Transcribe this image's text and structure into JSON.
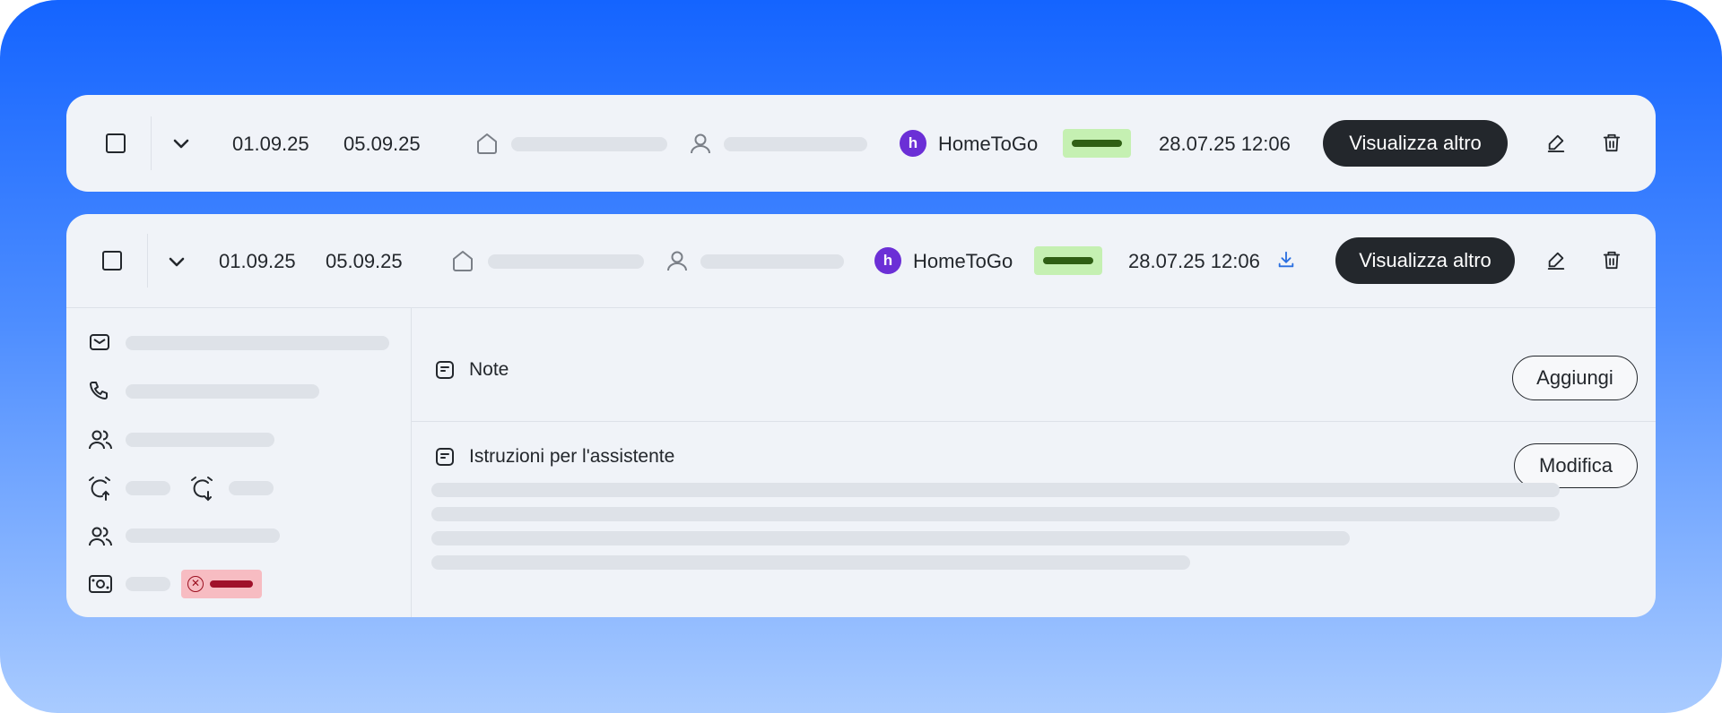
{
  "rows": [
    {
      "checkin": "01.09.25",
      "checkout": "05.09.25",
      "channel": "HomeToGo",
      "channel_logo": "h",
      "timestamp": "28.07.25 12:06",
      "more_label": "Visualizza altro"
    },
    {
      "checkin": "01.09.25",
      "checkout": "05.09.25",
      "channel": "HomeToGo",
      "channel_logo": "h",
      "timestamp": "28.07.25 12:06",
      "more_label": "Visualizza altro"
    }
  ],
  "details": {
    "notes": {
      "title": "Note",
      "button": "Aggiungi"
    },
    "instructions": {
      "title": "Istruzioni per l'assistente",
      "button": "Modifica"
    }
  },
  "icons": {
    "checkbox": "checkbox-icon",
    "expand": "chevron-down-icon",
    "property": "home-icon",
    "guest": "user-icon",
    "edit": "pencil-icon",
    "delete": "trash-icon",
    "download": "download-icon",
    "email": "mail-icon",
    "phone": "phone-icon",
    "guests": "users-icon",
    "checkin_time": "alarm-up-icon",
    "checkout_time": "alarm-down-icon",
    "payment": "cash-icon",
    "note": "note-icon"
  },
  "colors": {
    "background_top": "#1464ff",
    "background_bottom": "#a9cbff",
    "card": "#f0f3f8",
    "brand": "#6b2fd6",
    "status_ok_bg": "#c5f0b2",
    "status_ok_fg": "#2f5f14",
    "status_error_bg": "#f7bcc2",
    "status_error_fg": "#a0112a",
    "download_icon": "#2b6fe0"
  }
}
